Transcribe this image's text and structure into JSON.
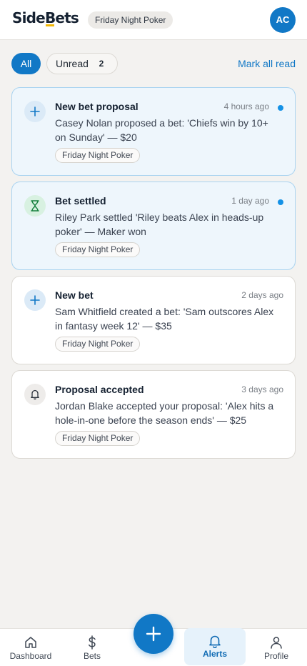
{
  "header": {
    "logo_part1": "Side",
    "logo_part2": "B",
    "logo_part3": "ets",
    "group": "Friday Night Poker",
    "avatar_initials": "AC"
  },
  "filters": {
    "all_label": "All",
    "unread_label": "Unread",
    "unread_count": "2",
    "mark_all_label": "Mark all read"
  },
  "notifications": [
    {
      "icon": "plus-icon",
      "title": "New bet proposal",
      "time": "4 hours ago",
      "body": "Casey Nolan proposed a bet: 'Chiefs win by 10+ on Sunday' — $20",
      "tag": "Friday Night Poker",
      "unread": true
    },
    {
      "icon": "hourglass-icon",
      "title": "Bet settled",
      "time": "1 day ago",
      "body": "Riley Park settled 'Riley beats Alex in heads-up poker' — Maker won",
      "tag": "Friday Night Poker",
      "unread": true
    },
    {
      "icon": "plus-icon",
      "title": "New bet",
      "time": "2 days ago",
      "body": "Sam Whitfield created a bet: 'Sam outscores Alex in fantasy week 12' — $35",
      "tag": "Friday Night Poker",
      "unread": false
    },
    {
      "icon": "bell-icon",
      "title": "Proposal accepted",
      "time": "3 days ago",
      "body": "Jordan Blake accepted your proposal: 'Alex hits a hole-in-one before the season ends' — $25",
      "tag": "Friday Night Poker",
      "unread": false
    }
  ],
  "nav": {
    "dashboard": "Dashboard",
    "bets": "Bets",
    "alerts": "Alerts",
    "profile": "Profile",
    "active": "alerts"
  },
  "colors": {
    "accent": "#1178c6",
    "unread_background": "#eef6fc",
    "unread_dot": "#1491e6",
    "logo_underline": "#f2b705"
  }
}
